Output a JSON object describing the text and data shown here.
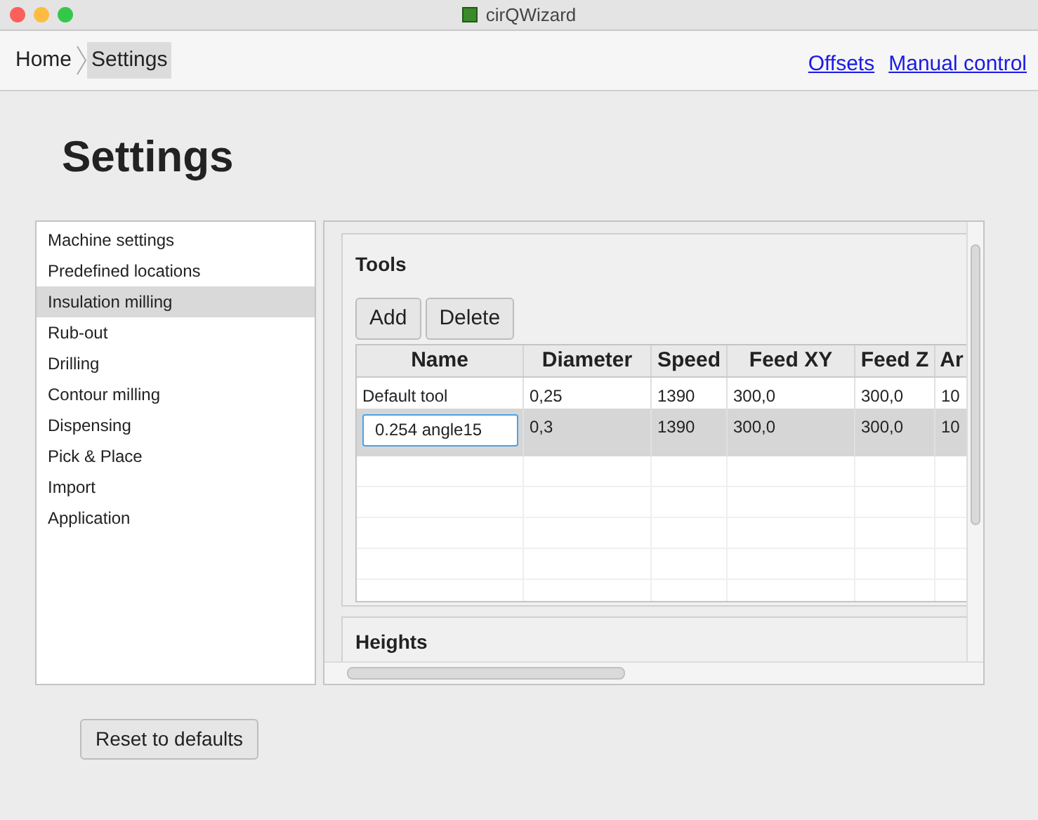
{
  "window": {
    "title": "cirQWizard"
  },
  "breadcrumb": [
    {
      "label": "Home",
      "selected": false
    },
    {
      "label": "Settings",
      "selected": true
    }
  ],
  "links": [
    "Offsets",
    "Manual control"
  ],
  "heading": "Settings",
  "sidebar": {
    "items": [
      {
        "label": "Machine settings",
        "selected": false
      },
      {
        "label": "Predefined locations",
        "selected": false
      },
      {
        "label": "Insulation milling",
        "selected": true
      },
      {
        "label": "Rub-out",
        "selected": false
      },
      {
        "label": "Drilling",
        "selected": false
      },
      {
        "label": "Contour milling",
        "selected": false
      },
      {
        "label": "Dispensing",
        "selected": false
      },
      {
        "label": "Pick & Place",
        "selected": false
      },
      {
        "label": "Import",
        "selected": false
      },
      {
        "label": "Application",
        "selected": false
      }
    ]
  },
  "tools": {
    "title": "Tools",
    "buttons": [
      "Add",
      "Delete"
    ],
    "table": {
      "columns": [
        "Name",
        "Diameter",
        "Speed",
        "Feed XY",
        "Feed Z",
        "Ar"
      ],
      "rows": [
        {
          "cells": [
            "Default tool",
            "0,25",
            "1390",
            "300,0",
            "300,0",
            "10"
          ],
          "selected": false,
          "editing": false
        },
        {
          "cells": [
            "0.254 angle15",
            "0,3",
            "1390",
            "300,0",
            "300,0",
            "10"
          ],
          "selected": true,
          "editing": true
        }
      ]
    }
  },
  "heights": {
    "title": "Heights"
  },
  "reset_button": "Reset to defaults"
}
